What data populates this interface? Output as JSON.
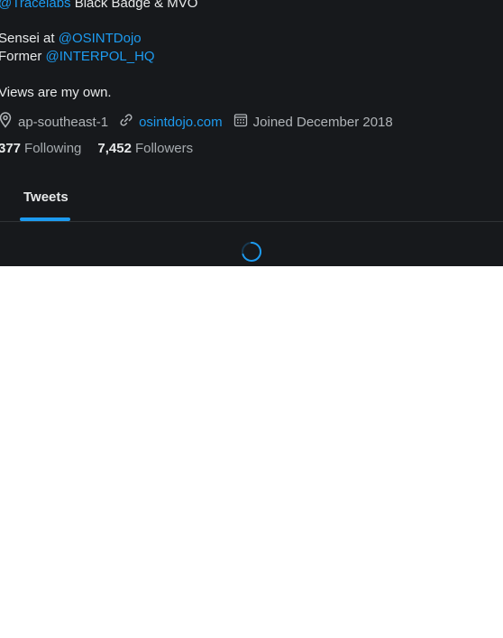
{
  "profile": {
    "bio": {
      "line1_handle": "@Tracelabs",
      "line1_text": " Black Badge & MVO",
      "line2_text": "Sensei at ",
      "line2_handle": "@OSINTDojo",
      "line3_text": "Former ",
      "line3_handle": "@INTERPOL_HQ",
      "line4_text": "Views are my own."
    },
    "meta": {
      "location": "ap-southeast-1",
      "website": "osintdojo.com",
      "joined": "Joined December 2018"
    },
    "stats": {
      "following_count": "377",
      "following_label": "Following",
      "followers_count": "7,452",
      "followers_label": "Followers"
    }
  },
  "tabs": [
    {
      "label": "Tweets",
      "active": true
    }
  ],
  "colors": {
    "background": "#17191c",
    "accent": "#1d9bf0",
    "text": "#e7e9ea",
    "muted": "#a6abaf"
  },
  "icons": {
    "location": "map-pin-icon",
    "website": "link-icon",
    "joined": "calendar-icon",
    "loading": "loading-spinner-icon"
  }
}
